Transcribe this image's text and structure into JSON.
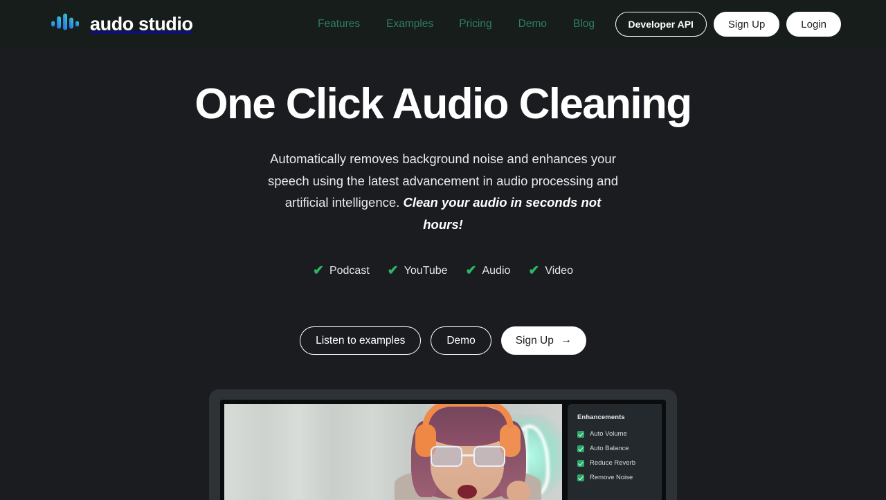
{
  "theme": {
    "page_bg": "#1a1c20",
    "header_bg": "#161d1b",
    "nav_link_color": "#2f7f63",
    "accent_green": "#2bb862",
    "logo_gradient_from": "#2563eb",
    "logo_gradient_to": "#3bc9c9",
    "text_primary": "#ffffff"
  },
  "header": {
    "logo": {
      "icon": "waveform-icon",
      "wordmark": "audo studio"
    },
    "nav": [
      {
        "label": "Features"
      },
      {
        "label": "Examples"
      },
      {
        "label": "Pricing"
      },
      {
        "label": "Demo"
      },
      {
        "label": "Blog"
      }
    ],
    "actions": {
      "developer_api": "Developer API",
      "sign_up": "Sign Up",
      "login": "Login"
    }
  },
  "hero": {
    "title": "One Click Audio Cleaning",
    "subtitle_plain": "Automatically removes background noise and enhances your speech using the latest advancement in audio processing and artificial intelligence. ",
    "subtitle_accent": "Clean your audio in seconds not hours!",
    "feature_tags": [
      {
        "icon": "check-icon",
        "label": "Podcast"
      },
      {
        "icon": "check-icon",
        "label": "YouTube"
      },
      {
        "icon": "check-icon",
        "label": "Audio"
      },
      {
        "icon": "check-icon",
        "label": "Video"
      }
    ],
    "cta": {
      "listen": "Listen to examples",
      "demo": "Demo",
      "sign_up": "Sign Up",
      "sign_up_arrow": "→"
    }
  },
  "mockup": {
    "device": "laptop",
    "video": {
      "description": "woman with pink hair wearing orange headphones and glasses"
    },
    "enhancements_panel": {
      "title": "Enhancements",
      "items": [
        {
          "label": "Auto Volume",
          "checked": true
        },
        {
          "label": "Auto Balance",
          "checked": true
        },
        {
          "label": "Reduce Reverb",
          "checked": true
        },
        {
          "label": "Remove Noise",
          "checked": true
        }
      ]
    }
  }
}
